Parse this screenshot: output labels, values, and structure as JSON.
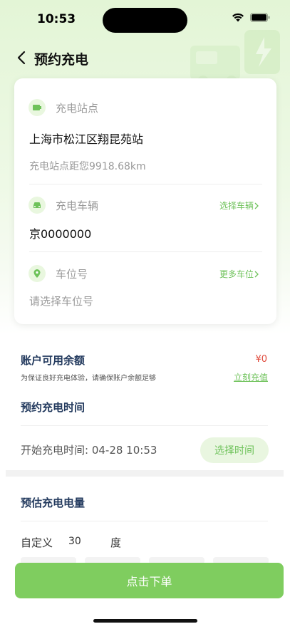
{
  "status_bar": {
    "time": "10:53"
  },
  "nav": {
    "title": "预约充电"
  },
  "station": {
    "label": "充电站点",
    "name": "上海市松江区翔昆苑站",
    "distance": "充电站点距您9918.68km"
  },
  "vehicle": {
    "label": "充电车辆",
    "link": "选择车辆",
    "plate": "京0000000"
  },
  "parking": {
    "label": "车位号",
    "link": "更多车位",
    "placeholder": "请选择车位号"
  },
  "balance": {
    "title": "账户可用余额",
    "amount": "¥0",
    "hint": "为保证良好充电体验，请确保账户余额足够",
    "recharge": "立刻充值"
  },
  "booking_time": {
    "title": "预约充电时间",
    "start_label": "开始充电时间: 04-28 10:53",
    "select_button": "选择时间"
  },
  "estimate": {
    "title": "预估充电电量",
    "custom_label": "自定义",
    "custom_value": "30",
    "unit": "度"
  },
  "submit": {
    "label": "点击下单"
  },
  "colors": {
    "accent": "#6ec25a",
    "button": "#7fcd5f",
    "title": "#233a5e",
    "price": "#e04a3c"
  }
}
